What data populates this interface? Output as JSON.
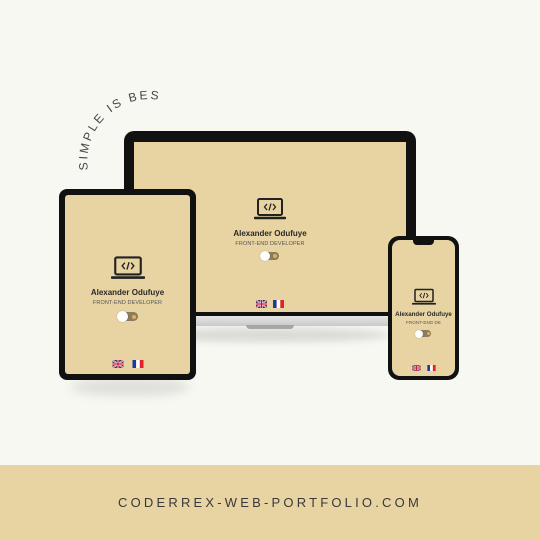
{
  "tagline": "SIMPLE IS BEST",
  "footer": {
    "url": "CODERREX-WEB-PORTFOLIO.COM"
  },
  "portfolio": {
    "name": "Alexander Odufuye",
    "role": "FRONT-END DEVELOPER",
    "role_phone": "FRONT-END DE",
    "languages": [
      "English",
      "French"
    ]
  },
  "colors": {
    "background": "#f8f8f3",
    "accent": "#e8d3a2",
    "device_frame": "#111111"
  },
  "icons": {
    "logo": "laptop-code-icon",
    "theme_toggle": "theme-toggle-switch",
    "flags": [
      "uk-flag-icon",
      "france-flag-icon"
    ]
  }
}
